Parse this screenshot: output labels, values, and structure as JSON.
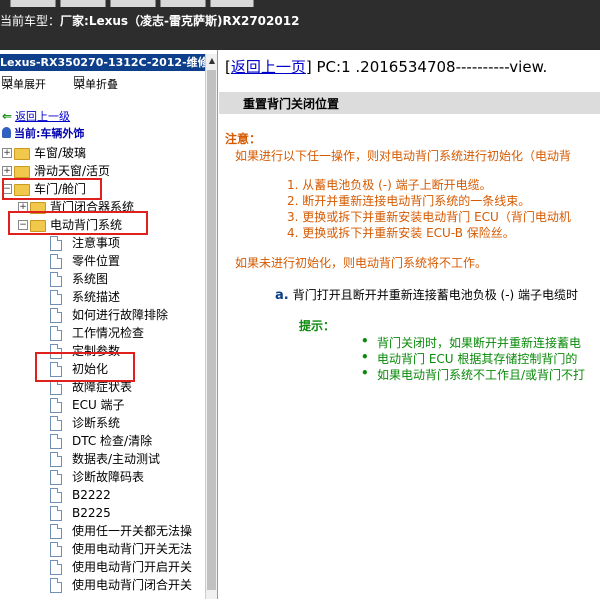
{
  "header": {
    "car_label": "当前车型：",
    "car_value": "厂家:Lexus（凌志-雷克萨斯)RX2702012"
  },
  "left_panel": {
    "title": "Lexus-RX350270-1312C-2012-维修",
    "menu": {
      "expand_all": "菜单展开",
      "collapse_all": "菜单折叠"
    },
    "back_link": "返回上一级",
    "current": "当前:车辆外饰",
    "tree": [
      {
        "label": "车窗/玻璃",
        "level": 0,
        "icon": "folder",
        "expander": "+"
      },
      {
        "label": "滑动天窗/活页",
        "level": 0,
        "icon": "folder",
        "expander": "+"
      },
      {
        "label": "车门/舱门",
        "level": 0,
        "icon": "folder",
        "expander": "-"
      },
      {
        "label": "背门闭合器系统",
        "level": 1,
        "icon": "folder",
        "expander": "+"
      },
      {
        "label": "电动背门系统",
        "level": 1,
        "icon": "folder",
        "expander": "-"
      },
      {
        "label": "注意事项",
        "level": 2,
        "icon": "doc"
      },
      {
        "label": "零件位置",
        "level": 2,
        "icon": "doc"
      },
      {
        "label": "系统图",
        "level": 2,
        "icon": "doc"
      },
      {
        "label": "系统描述",
        "level": 2,
        "icon": "doc"
      },
      {
        "label": "如何进行故障排除",
        "level": 2,
        "icon": "doc"
      },
      {
        "label": "工作情况检查",
        "level": 2,
        "icon": "doc"
      },
      {
        "label": "定制参数",
        "level": 2,
        "icon": "doc"
      },
      {
        "label": "初始化",
        "level": 2,
        "icon": "doc"
      },
      {
        "label": "故障症状表",
        "level": 2,
        "icon": "doc"
      },
      {
        "label": "ECU 端子",
        "level": 2,
        "icon": "doc"
      },
      {
        "label": "诊断系统",
        "level": 2,
        "icon": "doc"
      },
      {
        "label": "DTC 检查/清除",
        "level": 2,
        "icon": "doc"
      },
      {
        "label": "数据表/主动测试",
        "level": 2,
        "icon": "doc"
      },
      {
        "label": "诊断故障码表",
        "level": 2,
        "icon": "doc"
      },
      {
        "label": "B2222",
        "level": 2,
        "icon": "doc"
      },
      {
        "label": "B2225",
        "level": 2,
        "icon": "doc"
      },
      {
        "label": "使用任一开关都无法操",
        "level": 2,
        "icon": "doc"
      },
      {
        "label": "使用电动背门开关无法",
        "level": 2,
        "icon": "doc"
      },
      {
        "label": "使用电动背门开启开关",
        "level": 2,
        "icon": "doc"
      },
      {
        "label": "使用电动背门闭合开关",
        "level": 2,
        "icon": "doc"
      }
    ]
  },
  "right_panel": {
    "back_link": "返回上一页",
    "pc_text": "PC:1 .2016534708----------view.",
    "section_title": "重置背门关闭位置",
    "caution_label": "注意：",
    "caution_text": "如果进行以下任一操作，则对电动背门系统进行初始化（电动背",
    "steps": [
      "1. 从蓄电池负极 (-) 端子上断开电缆。",
      "2. 断开并重新连接电动背门系统的一条线束。",
      "3. 更换或拆下并重新安装电动背门 ECU（背门电动机",
      "4. 更换或拆下并重新安装 ECU-B 保险丝。"
    ],
    "no_init_text": "如果未进行初始化，则电动背门系统将不工作。",
    "step_a_letter": "a.",
    "step_a_text": "背门打开且断开并重新连接蓄电池负极 (-) 端子电缆时",
    "hint_label": "提示：",
    "hints": [
      "背门关闭时，如果断开并重新连接蓄电",
      "电动背门 ECU 根据其存储控制背门的",
      "如果电动背门系统不工作且/或背门不打"
    ]
  },
  "colors": {
    "orange": "#d65a00",
    "green": "#0a8a0a",
    "link": "#0000cc",
    "highlight_box": "#e0201c",
    "title_bar": "#0d3f8a"
  }
}
